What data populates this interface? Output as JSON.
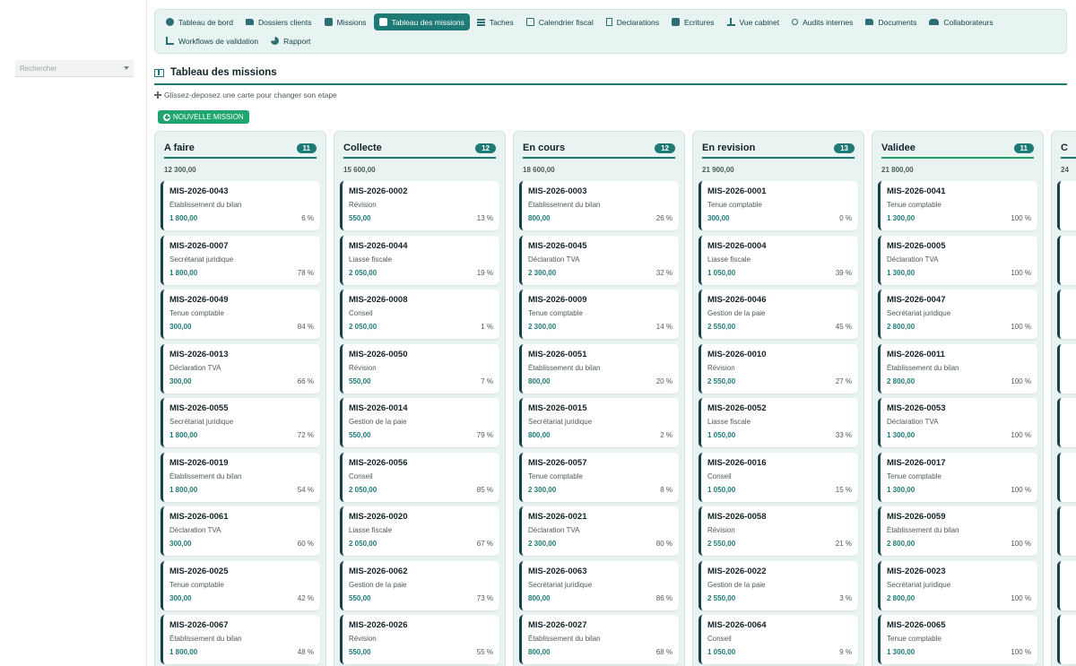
{
  "search": {
    "placeholder": "Rechercher"
  },
  "nav": [
    {
      "label": "Tableau de bord",
      "icon": "dashboard-icon",
      "active": false
    },
    {
      "label": "Dossiers clients",
      "icon": "folder-open-icon",
      "active": false
    },
    {
      "label": "Missions",
      "icon": "briefcase-icon",
      "active": false
    },
    {
      "label": "Tableau des missions",
      "icon": "columns-icon",
      "active": true
    },
    {
      "label": "Taches",
      "icon": "list-icon",
      "active": false
    },
    {
      "label": "Calendrier fiscal",
      "icon": "calendar-icon",
      "active": false
    },
    {
      "label": "Declarations",
      "icon": "file-icon",
      "active": false
    },
    {
      "label": "Ecritures",
      "icon": "book-icon",
      "active": false
    },
    {
      "label": "Vue cabinet",
      "icon": "scale-icon",
      "active": false
    },
    {
      "label": "Audits internes",
      "icon": "search-icon",
      "active": false
    },
    {
      "label": "Documents",
      "icon": "folder-icon",
      "active": false
    },
    {
      "label": "Collaborateurs",
      "icon": "users-icon",
      "active": false
    },
    {
      "label": "Workflows de validation",
      "icon": "sitemap-icon",
      "active": false
    },
    {
      "label": "Rapport",
      "icon": "chart-pie-icon",
      "active": false
    }
  ],
  "page": {
    "title": "Tableau des missions",
    "hint": "Glissez-deposez une carte pour changer son etape",
    "new_button": "NOUVELLE MISSION"
  },
  "columns": [
    {
      "title": "A faire",
      "count": "11",
      "total": "12 300,00",
      "cards": [
        {
          "id": "MIS-2026-0043",
          "type": "Établissement du bilan",
          "amount": "1 800,00",
          "pct": "6 %"
        },
        {
          "id": "MIS-2026-0007",
          "type": "Secrétariat juridique",
          "amount": "1 800,00",
          "pct": "78 %"
        },
        {
          "id": "MIS-2026-0049",
          "type": "Tenue comptable",
          "amount": "300,00",
          "pct": "84 %"
        },
        {
          "id": "MIS-2026-0013",
          "type": "Déclaration TVA",
          "amount": "300,00",
          "pct": "66 %"
        },
        {
          "id": "MIS-2026-0055",
          "type": "Secrétariat juridique",
          "amount": "1 800,00",
          "pct": "72 %"
        },
        {
          "id": "MIS-2026-0019",
          "type": "Établissement du bilan",
          "amount": "1 800,00",
          "pct": "54 %"
        },
        {
          "id": "MIS-2026-0061",
          "type": "Déclaration TVA",
          "amount": "300,00",
          "pct": "60 %"
        },
        {
          "id": "MIS-2026-0025",
          "type": "Tenue comptable",
          "amount": "300,00",
          "pct": "42 %"
        },
        {
          "id": "MIS-2026-0067",
          "type": "Établissement du bilan",
          "amount": "1 800,00",
          "pct": "48 %"
        }
      ]
    },
    {
      "title": "Collecte",
      "count": "12",
      "total": "15 600,00",
      "cards": [
        {
          "id": "MIS-2026-0002",
          "type": "Révision",
          "amount": "550,00",
          "pct": "13 %"
        },
        {
          "id": "MIS-2026-0044",
          "type": "Liasse fiscale",
          "amount": "2 050,00",
          "pct": "19 %"
        },
        {
          "id": "MIS-2026-0008",
          "type": "Conseil",
          "amount": "2 050,00",
          "pct": "1 %"
        },
        {
          "id": "MIS-2026-0050",
          "type": "Révision",
          "amount": "550,00",
          "pct": "7 %"
        },
        {
          "id": "MIS-2026-0014",
          "type": "Gestion de la paie",
          "amount": "550,00",
          "pct": "79 %"
        },
        {
          "id": "MIS-2026-0056",
          "type": "Conseil",
          "amount": "2 050,00",
          "pct": "85 %"
        },
        {
          "id": "MIS-2026-0020",
          "type": "Liasse fiscale",
          "amount": "2 050,00",
          "pct": "67 %"
        },
        {
          "id": "MIS-2026-0062",
          "type": "Gestion de la paie",
          "amount": "550,00",
          "pct": "73 %"
        },
        {
          "id": "MIS-2026-0026",
          "type": "Révision",
          "amount": "550,00",
          "pct": "55 %"
        }
      ]
    },
    {
      "title": "En cours",
      "count": "12",
      "total": "18 600,00",
      "cards": [
        {
          "id": "MIS-2026-0003",
          "type": "Établissement du bilan",
          "amount": "800,00",
          "pct": "26 %"
        },
        {
          "id": "MIS-2026-0045",
          "type": "Déclaration TVA",
          "amount": "2 300,00",
          "pct": "32 %"
        },
        {
          "id": "MIS-2026-0009",
          "type": "Tenue comptable",
          "amount": "2 300,00",
          "pct": "14 %"
        },
        {
          "id": "MIS-2026-0051",
          "type": "Établissement du bilan",
          "amount": "800,00",
          "pct": "20 %"
        },
        {
          "id": "MIS-2026-0015",
          "type": "Secrétariat juridique",
          "amount": "800,00",
          "pct": "2 %"
        },
        {
          "id": "MIS-2026-0057",
          "type": "Tenue comptable",
          "amount": "2 300,00",
          "pct": "8 %"
        },
        {
          "id": "MIS-2026-0021",
          "type": "Déclaration TVA",
          "amount": "2 300,00",
          "pct": "80 %"
        },
        {
          "id": "MIS-2026-0063",
          "type": "Secrétariat juridique",
          "amount": "800,00",
          "pct": "86 %"
        },
        {
          "id": "MIS-2026-0027",
          "type": "Établissement du bilan",
          "amount": "800,00",
          "pct": "68 %"
        }
      ]
    },
    {
      "title": "En revision",
      "count": "13",
      "total": "21 900,00",
      "cards": [
        {
          "id": "MIS-2026-0001",
          "type": "Tenue comptable",
          "amount": "300,00",
          "pct": "0 %"
        },
        {
          "id": "MIS-2026-0004",
          "type": "Liasse fiscale",
          "amount": "1 050,00",
          "pct": "39 %"
        },
        {
          "id": "MIS-2026-0046",
          "type": "Gestion de la paie",
          "amount": "2 550,00",
          "pct": "45 %"
        },
        {
          "id": "MIS-2026-0010",
          "type": "Révision",
          "amount": "2 550,00",
          "pct": "27 %"
        },
        {
          "id": "MIS-2026-0052",
          "type": "Liasse fiscale",
          "amount": "1 050,00",
          "pct": "33 %"
        },
        {
          "id": "MIS-2026-0016",
          "type": "Conseil",
          "amount": "1 050,00",
          "pct": "15 %"
        },
        {
          "id": "MIS-2026-0058",
          "type": "Révision",
          "amount": "2 550,00",
          "pct": "21 %"
        },
        {
          "id": "MIS-2026-0022",
          "type": "Gestion de la paie",
          "amount": "2 550,00",
          "pct": "3 %"
        },
        {
          "id": "MIS-2026-0064",
          "type": "Conseil",
          "amount": "1 050,00",
          "pct": "9 %"
        }
      ]
    },
    {
      "title": "Validee",
      "count": "11",
      "total": "21 800,00",
      "green": true,
      "cards": [
        {
          "id": "MIS-2026-0041",
          "type": "Tenue comptable",
          "amount": "1 300,00",
          "pct": "100 %"
        },
        {
          "id": "MIS-2026-0005",
          "type": "Déclaration TVA",
          "amount": "1 300,00",
          "pct": "100 %"
        },
        {
          "id": "MIS-2026-0047",
          "type": "Secrétariat juridique",
          "amount": "2 800,00",
          "pct": "100 %"
        },
        {
          "id": "MIS-2026-0011",
          "type": "Établissement du bilan",
          "amount": "2 800,00",
          "pct": "100 %"
        },
        {
          "id": "MIS-2026-0053",
          "type": "Déclaration TVA",
          "amount": "1 300,00",
          "pct": "100 %"
        },
        {
          "id": "MIS-2026-0017",
          "type": "Tenue comptable",
          "amount": "1 300,00",
          "pct": "100 %"
        },
        {
          "id": "MIS-2026-0059",
          "type": "Établissement du bilan",
          "amount": "2 800,00",
          "pct": "100 %"
        },
        {
          "id": "MIS-2026-0023",
          "type": "Secrétariat juridique",
          "amount": "2 800,00",
          "pct": "100 %"
        },
        {
          "id": "MIS-2026-0065",
          "type": "Tenue comptable",
          "amount": "1 300,00",
          "pct": "100 %"
        }
      ]
    },
    {
      "title": "C",
      "count": "",
      "total": "24",
      "cards": [
        {
          "id": "",
          "type": "",
          "amount": "",
          "pct": ""
        },
        {
          "id": "",
          "type": "",
          "amount": "",
          "pct": ""
        },
        {
          "id": "",
          "type": "",
          "amount": "",
          "pct": ""
        },
        {
          "id": "",
          "type": "",
          "amount": "",
          "pct": ""
        },
        {
          "id": "",
          "type": "",
          "amount": "",
          "pct": ""
        },
        {
          "id": "",
          "type": "",
          "amount": "",
          "pct": ""
        },
        {
          "id": "",
          "type": "",
          "amount": "",
          "pct": ""
        },
        {
          "id": "",
          "type": "",
          "amount": "",
          "pct": ""
        },
        {
          "id": "",
          "type": "",
          "amount": "",
          "pct": ""
        }
      ]
    }
  ]
}
